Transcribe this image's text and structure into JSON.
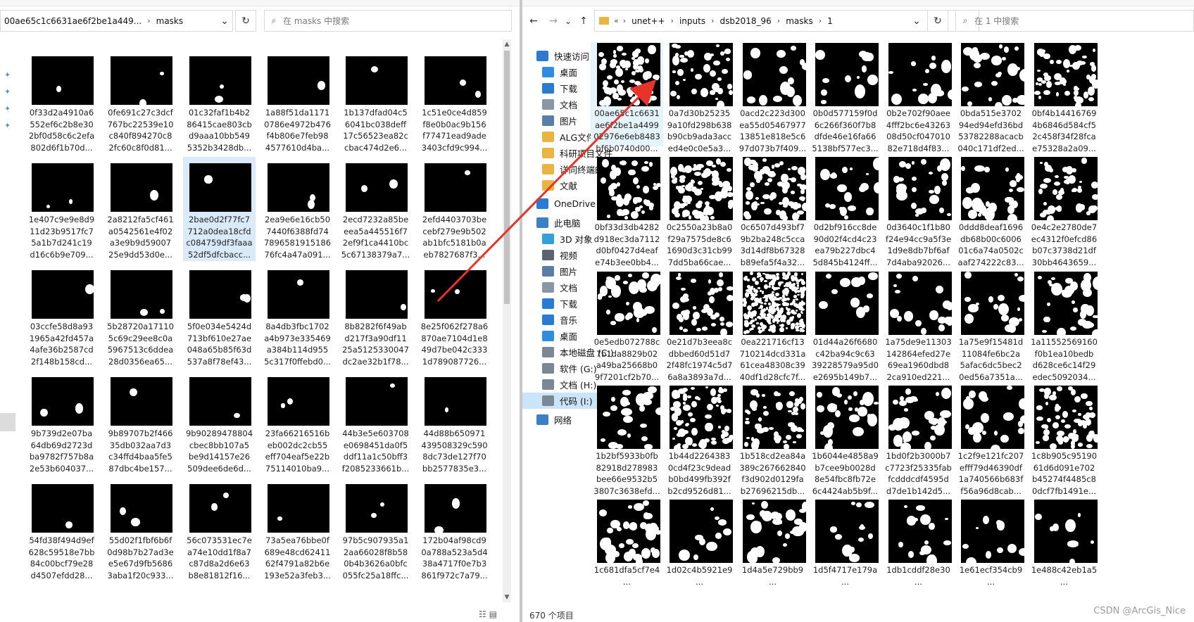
{
  "left": {
    "top_strip": "",
    "address": {
      "path_label": "00ae65c1c6631ae6f2be1a449...",
      "folder": "masks",
      "sep": "›"
    },
    "dropdown": "⌄",
    "refresh": "↻",
    "search_placeholder": "在 masks 中搜索",
    "files": [
      [
        "0f33d2a4910a6\n552ef6c2b8e30\n2bf0d58c6c2efa\n802d6f1b70d...",
        "0fe691c27c3dcf\n767bc22539e10\nc840f894270c8\n2fc60c8f0d81...",
        "01c32faf1b4b2\n86415cae803cb\nd9aaa10bb549\n5352b3428db...",
        "1a88f51da1171\n0786e4972b476\nf4b806e7feb98\n4577610d4ba...",
        "1b137dfad04c5\n6041bc038deff\n17c56523ea82c\ncbac474d2e6...",
        "1c51e0ce4d859\nf8e0b0ac9b156\nf77471ead9ade\n3403cfd9c994..."
      ],
      [
        "1e407c9e9e8d9\n11d23b9517fc7\n5a1b7d241c19\nd16c6b9e709...",
        "2a8212fa5cf461\na0542561e4f02\na3e9b9d59007\n25e9dd53d0e...",
        "2bae0d2f77fc7\n712a0dea18cfd\nc084759df3faaa\n52df5dfcbacc...",
        "2ea9e6e16cb50\n7440f6388fd74\n7896581915186\n76fc4a47a091...",
        "2ecd7232a85be\neea5a445516f7\n2ef9f1ca4410bc\n5c67138379a7...",
        "2efd4403703be\ncebf279e9b502\nab1bfc5181b0a\neb7827687f3..."
      ],
      [
        "03ccfe58d8a93\n1965a42fd457a\n4afe36b2587cd\n2f148b158cd...",
        "5b28720a17110\n5c69c29ee8c0a\n5967513c6ddea\n28d0356ea65...",
        "5f0e034e5424d\n713bf610e27ae\n048a65b85f63d\n537a8f78ef43...",
        "8a4db3fbc1702\na4b973e335469\na384b114d955\n5c317f0ffebd0...",
        "8b8282f6f49ab\nd217f3a90df11\n25a5125330047\ndc2ae32b1f78...",
        "8e25f062f278a6\n870ae7104d1e8\n49d7be042c333\n1d789087726..."
      ],
      [
        "9b739d2e07ba\n64db69d2723d\nba9782f757b8a\n2e53b604037...",
        "9b89707b2f466\n35db032aa7d3\nc34ffd4baa5fe5\n87dbc4be157...",
        "9b90289478804\ncbec8bb107a5\nbe9d14157e26\n509dee6de6d...",
        "23fa66216516b\neb002dc2cb55\neff704eaf5e22b\n75114010ba9...",
        "44b3e5e603708\ne0698451da0f5\nddf11a1c50bff3\nf2085233661b...",
        "44d88b650971\n439508329c590\n8dc73de127f70\nbb2577835e3..."
      ],
      [
        "54fd38f494d9ef\n628c59518e7bb\n84c00bcf79e28\nd4507efdd28...",
        "55d02f1fbf6b6f\n0d98b7b27ad3e\ne5e67d9fb5686\n3aba1f20c933...",
        "56c073531ec7e\na74e10dd1f8a7\nc87d8a2d6e63\nb8e81812f16...",
        "73a5ea76bbe0f\n689e48cd62411\n62f4791a82b6e\n193e52a3feb3...",
        "97b5c907935a1\n2aa66028f8b58\n0b4b3626a0bfc\n055fc25a18ffc...",
        "172b04af98cd9\n0a788a523a5d4\n38a4717f0e7b3\n861f972c7a79..."
      ]
    ],
    "status_views": "☷ ▤"
  },
  "right": {
    "top_strip": "",
    "nav_back": "←",
    "nav_forward": "→",
    "nav_recent": "⌄",
    "nav_up": "↑",
    "address": {
      "overflow": "«",
      "segments": [
        "unet++",
        "inputs",
        "dsb2018_96",
        "masks",
        "1"
      ],
      "sep": "›"
    },
    "dropdown": "⌄",
    "refresh": "↻",
    "search_placeholder": "在 1 中搜索",
    "nav_items": [
      {
        "label": "快速访问",
        "color": "#2e7ad1"
      },
      {
        "label": "桌面",
        "color": "#2f8ce0"
      },
      {
        "label": "下载",
        "color": "#2a7bd3"
      },
      {
        "label": "文档",
        "color": "#8a96a6"
      },
      {
        "label": "图片",
        "color": "#5a7ea6"
      },
      {
        "label": "ALG文件",
        "color": "#e8b640"
      },
      {
        "label": "科研项目文件",
        "color": "#e8b640"
      },
      {
        "label": "详同终端的",
        "color": "#e8b640"
      },
      {
        "label": "文献",
        "color": "#e8b640"
      },
      {
        "label": "OneDrive",
        "color": "#2a7bd3"
      },
      {
        "label": "此电脑",
        "color": "#3b7fc4"
      },
      {
        "label": "3D 对象",
        "color": "#33a1d8"
      },
      {
        "label": "视频",
        "color": "#5b6470"
      },
      {
        "label": "图片",
        "color": "#5a7ea6"
      },
      {
        "label": "文档",
        "color": "#8a96a6"
      },
      {
        "label": "下载",
        "color": "#2a7bd3"
      },
      {
        "label": "音乐",
        "color": "#2a7bd3"
      },
      {
        "label": "桌面",
        "color": "#2f8ce0"
      },
      {
        "label": "本地磁盘 (C:)",
        "color": "#7a8794"
      },
      {
        "label": "软件 (G:)",
        "color": "#7a8794"
      },
      {
        "label": "文档 (H:)",
        "color": "#7a8794"
      },
      {
        "label": "代码 (I:)",
        "color": "#7a8794"
      },
      {
        "label": "网络",
        "color": "#3b7fc4"
      }
    ],
    "files": [
      [
        "00ae65c1c6631\nae6f2be1a4499\n02976e6eb8483\nbf6b0740d00...",
        "0a7d30b25235\n9a10fd298b638\nb90cb9ada3acc\ned4e0c0e5a3...",
        "0acd2c223d300\nea55d05467977\n13851e818e5c6\n97d073b7f409...",
        "0b0d577159f0d\n6c266f360f7b8\ndfde46e16fa66\n5138bf577ec3...",
        "0b2e702f90aee\n4fff2bc6e43263\n08d50cf047010\n82e718d4f83...",
        "0bda515e3702\n94ed94efd36bd\n53782288acacb\n040c171df2ed...",
        "0bf4b14416769\n4b6846d584cf5\n2c458f34f28fca\ne75328a2a09..."
      ],
      [
        "0bf33d3db4282\nd918ec3da7112\nd0bf0427d4eaf\ne74b3ee0bb4...",
        "0c2550a23b8a0\nf29a7575de8c6\n1690d3c31cb99\n7dd5ba66cae...",
        "0c6507d493bf7\n9b2ba248c5cca\n3d14df8b67328\nb89efa5f4a32...",
        "0d2bf916cc8de\n90d02f4cd4c23\nea79b227dbc4\n5d845b4124ff...",
        "0d3640c1f1b80\nf24e94cc9a5f3e\n1d9e8db7bf6af\n7d4aba92026...",
        "0ddd8deaf1696\ndb68b00c6006\n01c6a74a0502c\naaf274222c83...",
        "0e4c2e2780de7\nec4312f0efcd86\nb07c3738d21df\n30bb4643659..."
      ],
      [
        "0e5edb072788c\n7b1da8829b02\na49ba25668b0\n9f7201cf2b70...",
        "0e21d7b3eea8c\ndbbed60d51d7\n2f48fc1974c5d7\n6a8a3893a7d...",
        "0ea221716cf13\n710214dcd331a\n61cea48308c39\n40df1d28cfc7f...",
        "01d44a26f6680\nc42ba94c9c63\n39228579a95d0\ne2695b149b7...",
        "1a75de9e11303\n142864efed27e\n69ea1960dbd8\n2ca910ed221...",
        "1a75e9f15481d\n11084fe6bc2a\n5afac6dc5bec2\n0ed56a7351a...",
        "1a11552569160\nf0b1ea10bedb\nd628ce6c14f29\nedec5092034..."
      ],
      [
        "1b2bf5933b0fb\n82918d278983\nbee66e9532b5\n3807c3638efd...",
        "1b44d2264383\n0cd4f23c9dead\nb0bd499fb392f\nb2cd9526d81...",
        "1b518cd2ea84a\n389c267662840\nf3d902d0129fa\nb27696215db...",
        "1b6044e4858a9\nb7cee9b0028d\n8e54fbc8fb72e\n6c4424ab5b9f...",
        "1bd0f2b3000b7\nc7723f25335fab\nfcdddcdf4595d\nd7de1b142d5...",
        "1c2f9e121fc207\nefff79d46390df\n1a740566b683f\nf56a96d8cab...",
        "1c8b905c95190\n61d6d091e702\nb45274f4485c8\n0dcf7fb1491e..."
      ],
      [
        "1c681dfa5cf7e4\n...",
        "1d02c4b5921e9\n...",
        "1d4a5e729bb9\n...",
        "1d5f4717e179a\n...",
        "1db1cddf28e30\n...",
        "1e61ecf354cb9\n...",
        "1e488c42eb1a5\n..."
      ]
    ],
    "status": "670 个项目",
    "status_views": "☷ ▤"
  },
  "watermark": "CSDN @ArcGis_Nice",
  "colors": {
    "arrow": "#e8332a",
    "selection": "#cce4f7",
    "tile_select": "#dbeaf9"
  }
}
